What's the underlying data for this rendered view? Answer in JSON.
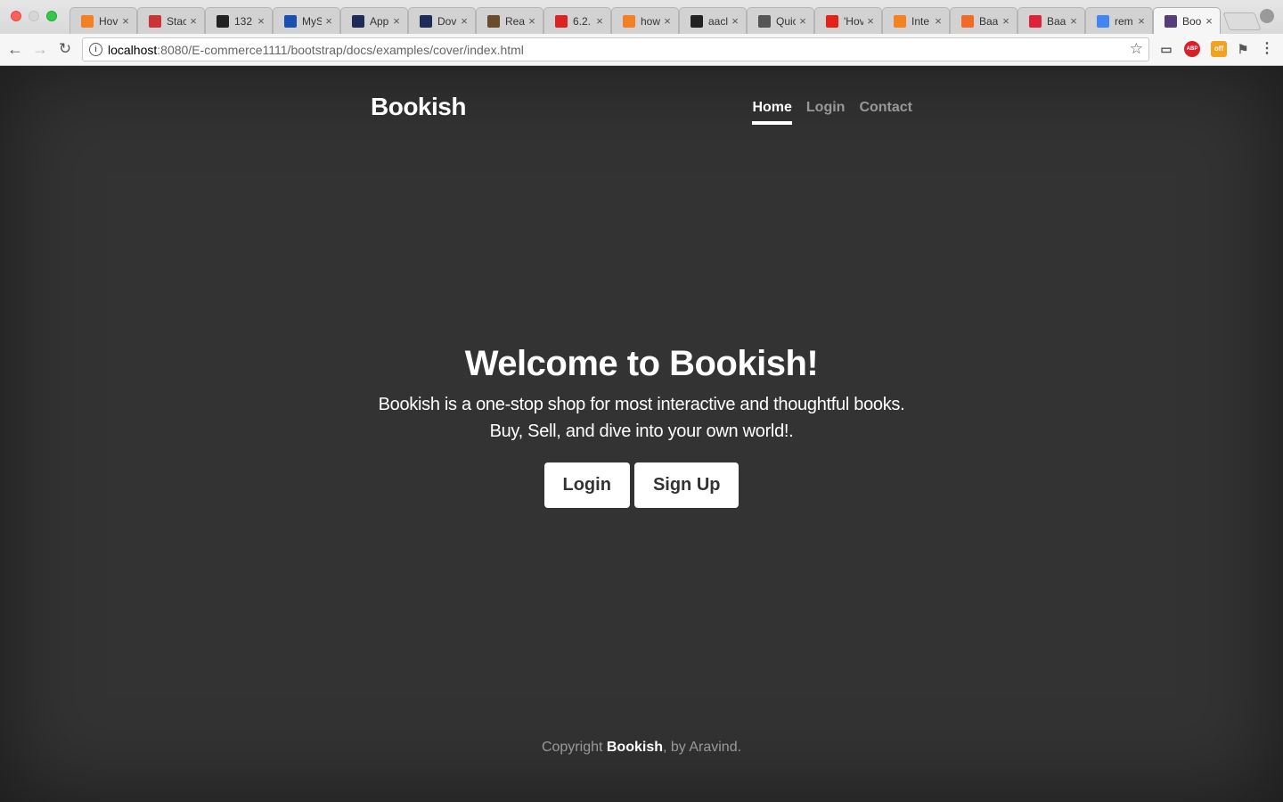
{
  "browser": {
    "tabs": [
      {
        "title": "Hov",
        "icon": "stackoverflow-icon",
        "color": "#f48024"
      },
      {
        "title": "Stac",
        "icon": "stackexchange-icon",
        "color": "#c33"
      },
      {
        "title": "132",
        "icon": "github-icon",
        "color": "#222"
      },
      {
        "title": "MyS",
        "icon": "t-icon",
        "color": "#1a4fb3"
      },
      {
        "title": "App",
        "icon": "eye-icon",
        "color": "#1e2a5a"
      },
      {
        "title": "Dov",
        "icon": "eye-icon",
        "color": "#1e2a5a"
      },
      {
        "title": "Rea",
        "icon": "photo-icon",
        "color": "#6b4b2a"
      },
      {
        "title": "6.2.",
        "icon": "dr-icon",
        "color": "#d22"
      },
      {
        "title": "how",
        "icon": "stackoverflow-icon",
        "color": "#f48024"
      },
      {
        "title": "aacl",
        "icon": "github-icon",
        "color": "#222"
      },
      {
        "title": "Quic",
        "icon": "doc-icon",
        "color": "#555"
      },
      {
        "title": "'Hov",
        "icon": "youtube-icon",
        "color": "#e62117"
      },
      {
        "title": "Inte",
        "icon": "flame-icon",
        "color": "#f58220"
      },
      {
        "title": "Baa",
        "icon": "b-icon",
        "color": "#f36a24"
      },
      {
        "title": "Baa",
        "icon": "circle-icon",
        "color": "#e0213a"
      },
      {
        "title": "rem",
        "icon": "google-icon",
        "color": "#4285f4"
      },
      {
        "title": "Boo",
        "icon": "bootstrap-icon",
        "color": "#563d7c",
        "active": true
      }
    ],
    "url_host": "localhost",
    "url_path": ":8080/E-commerce1111/bootstrap/docs/examples/cover/index.html",
    "extensions": {
      "abp": "ABP",
      "off": "off"
    }
  },
  "site": {
    "brand": "Bookish",
    "nav": [
      {
        "label": "Home",
        "active": true
      },
      {
        "label": "Login",
        "active": false
      },
      {
        "label": "Contact",
        "active": false
      }
    ],
    "hero": {
      "title": "Welcome to Bookish!",
      "lead_line1": "Bookish is a one-stop shop for most interactive and thoughtful books.",
      "lead_line2": "Buy, Sell, and dive into your own world!.",
      "login_label": "Login",
      "signup_label": "Sign Up"
    },
    "footer": {
      "prefix": "Copyright ",
      "brand": "Bookish",
      "suffix": ", by Aravind."
    }
  }
}
